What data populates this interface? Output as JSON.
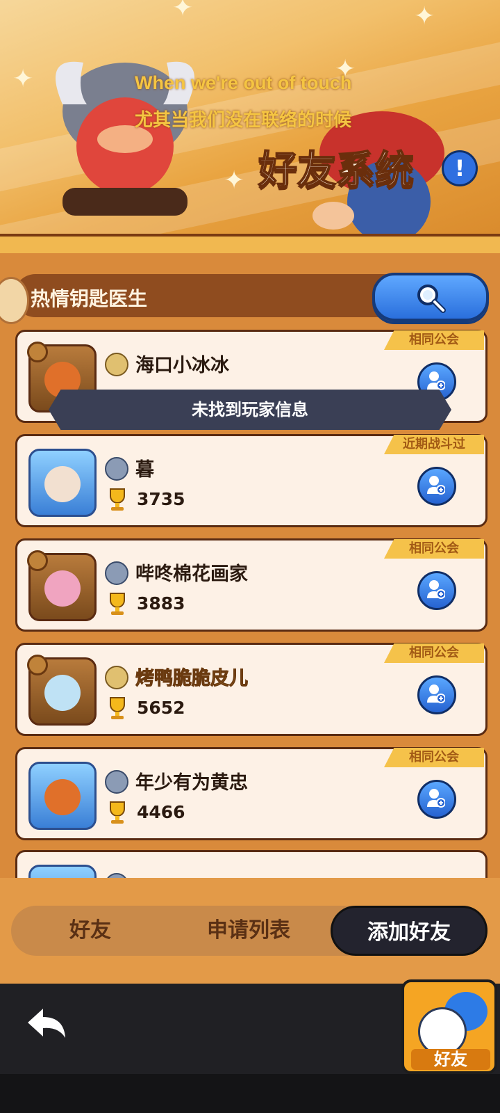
{
  "banner": {
    "subtitle_en": "When we're out of touch",
    "subtitle_cn": "尤其当我们没在联络的时候",
    "title": "好友系统",
    "info_label": "!"
  },
  "search": {
    "query": "热情钥匙医生"
  },
  "toast": {
    "message": "未找到玩家信息"
  },
  "players": [
    {
      "name": "海口小冰冰",
      "score": "",
      "tag": "相同公会"
    },
    {
      "name": "暮",
      "score": "3735",
      "tag": "近期战斗过"
    },
    {
      "name": "哔咚棉花画家",
      "score": "3883",
      "tag": "相同公会"
    },
    {
      "name": "烤鸭脆脆皮儿",
      "score": "5652",
      "tag": "相同公会"
    },
    {
      "name": "年少有为黄忠",
      "score": "4466",
      "tag": "相同公会"
    }
  ],
  "tabs": [
    {
      "label": "好友"
    },
    {
      "label": "申请列表"
    },
    {
      "label": "添加好友"
    }
  ],
  "bottom": {
    "friend_label": "好友"
  },
  "colors": {
    "accent_blue": "#2f6fe0",
    "tag_yellow": "#f5c24a",
    "panel_orange": "#d98a3b"
  }
}
